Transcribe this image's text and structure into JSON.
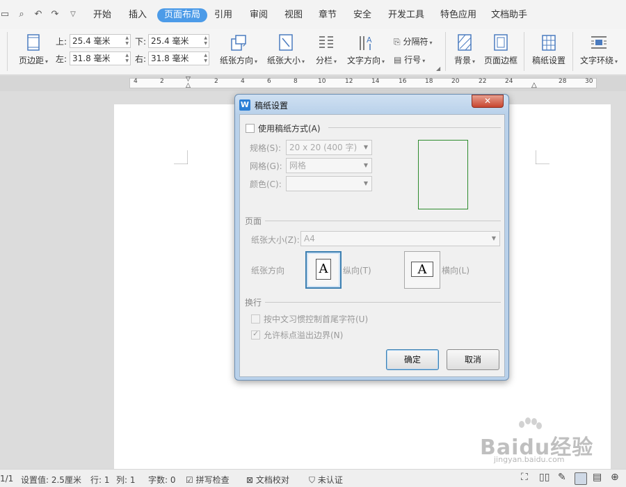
{
  "menubar": {
    "tabs": [
      {
        "label": "开始",
        "active": false
      },
      {
        "label": "插入",
        "active": false
      },
      {
        "label": "页面布局",
        "active": true
      },
      {
        "label": "引用",
        "active": false
      },
      {
        "label": "审阅",
        "active": false
      },
      {
        "label": "视图",
        "active": false
      },
      {
        "label": "章节",
        "active": false
      },
      {
        "label": "安全",
        "active": false
      },
      {
        "label": "开发工具",
        "active": false
      },
      {
        "label": "特色应用",
        "active": false
      },
      {
        "label": "文档助手",
        "active": false
      }
    ],
    "accent": "#4c9be8"
  },
  "ribbon": {
    "margins_label": "页边距",
    "top_label": "上:",
    "top_value": "25.4 毫米",
    "bottom_label": "下:",
    "bottom_value": "25.4 毫米",
    "left_label": "左:",
    "left_value": "31.8 毫米",
    "right_label": "右:",
    "right_value": "31.8 毫米",
    "orientation_label": "纸张方向",
    "size_label": "纸张大小",
    "columns_label": "分栏",
    "text_direction_label": "文字方向",
    "breaks_label": "分隔符",
    "line_numbers_label": "行号",
    "background_label": "背景",
    "page_border_label": "页面边框",
    "manuscript_label": "稿纸设置",
    "text_wrap_label": "文字环绕"
  },
  "ruler": {
    "numbers": [
      "4",
      "2",
      "2",
      "4",
      "6",
      "8",
      "10",
      "12",
      "14",
      "16",
      "18",
      "20",
      "22",
      "24",
      "28",
      "30"
    ]
  },
  "dialog": {
    "title": "稿纸设置",
    "close_glyph": "✕",
    "use_manuscript_label": "使用稿纸方式(A)",
    "use_manuscript_checked": false,
    "spec_label": "规格(S):",
    "spec_value": "20 x 20 (400 字)",
    "grid_label": "网格(G):",
    "grid_value": "网格",
    "color_label": "颜色(C):",
    "color_value": "",
    "page_section": "页面",
    "paper_size_label": "纸张大小(Z):",
    "paper_size_value": "A4",
    "orientation_label": "纸张方向",
    "portrait_label": "纵向(T)",
    "landscape_label": "横向(L)",
    "orientation_glyph": "A",
    "selected_orientation": "portrait",
    "wrap_section": "换行",
    "chinese_control_label": "按中文习惯控制首尾字符(U)",
    "chinese_control_checked": false,
    "punct_overflow_label": "允许标点溢出边界(N)",
    "punct_overflow_checked": true,
    "ok_label": "确定",
    "cancel_label": "取消"
  },
  "statusbar": {
    "page_info": "1/1",
    "setting_value": "设置值: 2.5厘米",
    "row": "行: 1",
    "col": "列: 1",
    "word_count": "字数: 0",
    "spell_check": "拼写检查",
    "doc_proof": "文档校对",
    "uncertified": "未认证"
  },
  "watermark": {
    "logo": "Baidu经验",
    "url": "jingyan.baidu.com"
  }
}
